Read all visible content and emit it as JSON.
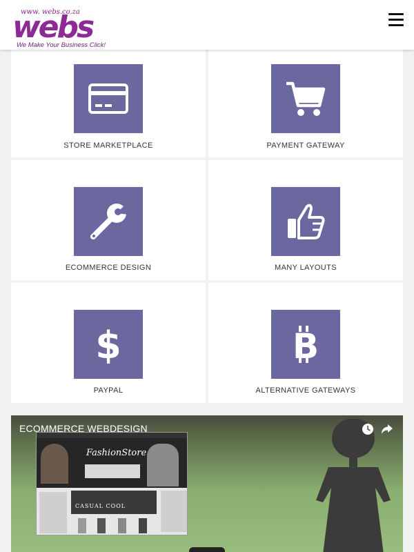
{
  "header": {
    "logo": {
      "url_text": "www. webs.co.za",
      "word": "webs",
      "tagline": "We Make Your Business Click!"
    },
    "menu_icon": "hamburger-menu-icon"
  },
  "colors": {
    "accent": "#6b68a0",
    "logo_purple": "#8e2a96",
    "tile_bg": "#ffffff",
    "page_bg": "#f1f1f1"
  },
  "features": [
    {
      "label": "STORE MARKETPLACE",
      "icon": "credit-card-icon"
    },
    {
      "label": "PAYMENT GATEWAY",
      "icon": "shopping-cart-icon"
    },
    {
      "label": "ECOMMERCE DESIGN",
      "icon": "wrench-icon"
    },
    {
      "label": "MANY LAYOUTS",
      "icon": "thumbs-up-icon"
    },
    {
      "label": "PAYPAL",
      "icon": "dollar-icon"
    },
    {
      "label": "ALTERNATIVE GATEWAYS",
      "icon": "bitcoin-icon"
    }
  ],
  "video": {
    "title": "ECOMMERCE WEBDESIGN",
    "icons": [
      "watch-later-icon",
      "share-icon"
    ],
    "thumbnail": {
      "store_name": "FashionStore",
      "banner_text": "CASUAL COOL"
    }
  }
}
